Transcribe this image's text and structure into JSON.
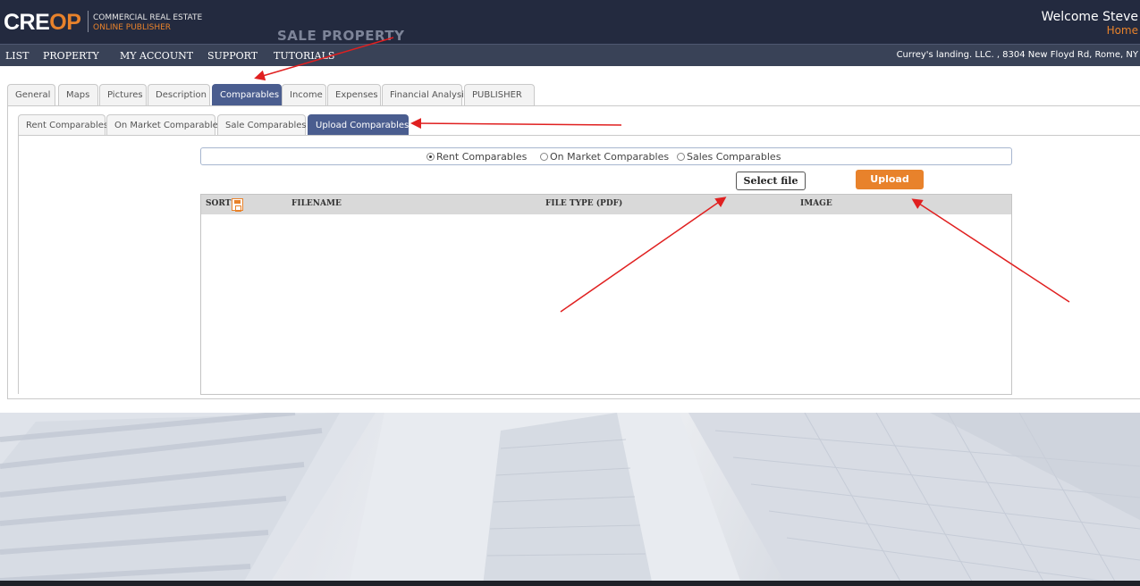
{
  "header": {
    "logo_cre": "CRE",
    "logo_op": "OP",
    "logo_line1": "COMMERCIAL REAL ESTATE",
    "logo_line2": "ONLINE PUBLISHER",
    "page_heading": "SALE PROPERTY",
    "welcome": "Welcome Steve",
    "home_link": "Home"
  },
  "navbar": {
    "items": [
      "LIST",
      "PROPERTY",
      "MY ACCOUNT",
      "SUPPORT",
      "TUTORIALS"
    ],
    "address": "Currey's landing. LLC. , 8304 New Floyd Rd, Rome, NY"
  },
  "main_tabs": {
    "items": [
      "General",
      "Maps",
      "Pictures",
      "Description",
      "Comparables",
      "Income",
      "Expenses",
      "Financial Analysis",
      "PUBLISHER"
    ],
    "active": "Comparables"
  },
  "sub_tabs": {
    "items": [
      "Rent Comparables",
      "On Market Comparables",
      "Sale Comparables",
      "Upload Comparables"
    ],
    "active": "Upload Comparables"
  },
  "radios": {
    "options": [
      "Rent Comparables",
      "On Market Comparables",
      "Sales Comparables"
    ],
    "selected": "Rent Comparables"
  },
  "buttons": {
    "select_file": "Select file",
    "upload": "Upload"
  },
  "table": {
    "columns": [
      "SORT",
      "FILENAME",
      "FILE TYPE (PDF)",
      "IMAGE"
    ],
    "rows": []
  },
  "colors": {
    "header_bg": "#232a3f",
    "nav_bg": "#394257",
    "accent_orange": "#e8822b",
    "active_tab": "#4a5d8f",
    "annotation_arrow": "#e02020"
  },
  "icons": {
    "sort": "save-disk-icon"
  }
}
